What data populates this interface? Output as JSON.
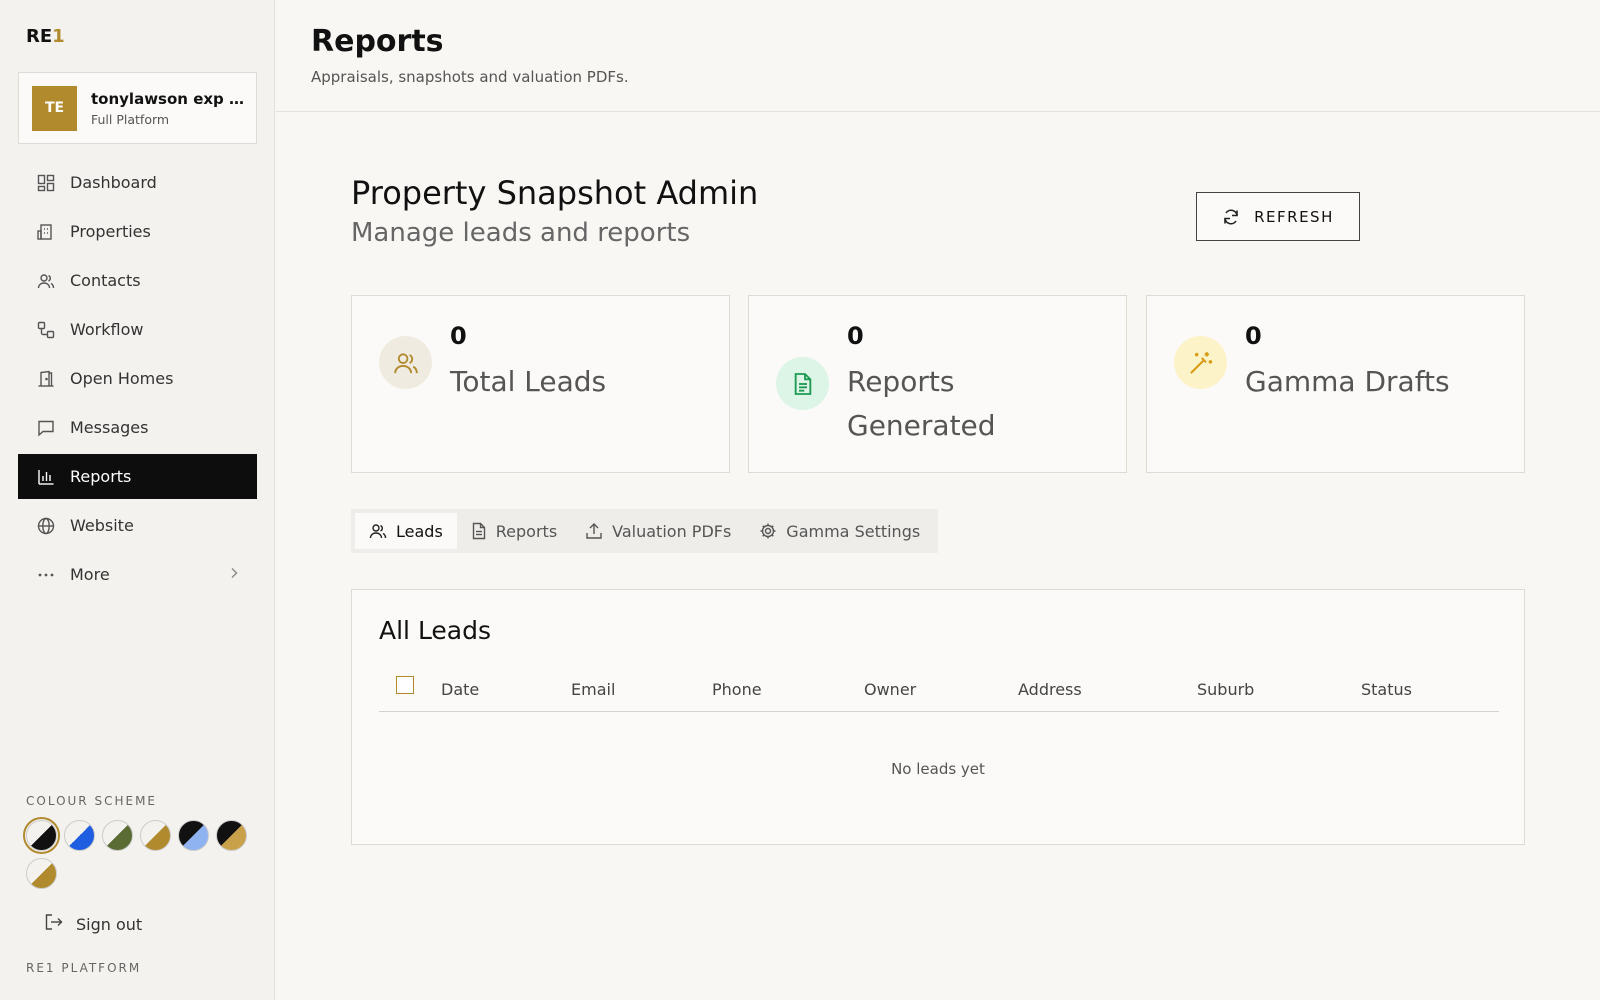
{
  "brand": {
    "logo_main": "RE",
    "logo_accent": "1",
    "accent": "#b08a2c"
  },
  "account": {
    "initials": "TE",
    "name": "tonylawson exp &...",
    "plan": "Full Platform"
  },
  "nav": [
    {
      "label": "Dashboard",
      "icon": "dashboard-icon"
    },
    {
      "label": "Properties",
      "icon": "building-icon"
    },
    {
      "label": "Contacts",
      "icon": "users-icon"
    },
    {
      "label": "Workflow",
      "icon": "workflow-icon"
    },
    {
      "label": "Open Homes",
      "icon": "door-icon"
    },
    {
      "label": "Messages",
      "icon": "message-icon"
    },
    {
      "label": "Reports",
      "icon": "bar-chart-icon",
      "active": true
    },
    {
      "label": "Website",
      "icon": "globe-icon"
    },
    {
      "label": "More",
      "icon": "more-icon"
    }
  ],
  "colour_scheme": {
    "label": "COLOUR SCHEME",
    "swatches": [
      {
        "a": "#f3f2ef",
        "b": "#111111",
        "selected": true
      },
      {
        "a": "#f3f2ef",
        "b": "#1f5ee0"
      },
      {
        "a": "#f3f2ef",
        "b": "#5a6b34"
      },
      {
        "a": "#f3f2ef",
        "b": "#b08a2c"
      },
      {
        "a": "#111111",
        "b": "#8fb2f0"
      },
      {
        "a": "#111111",
        "b": "#c9a14a"
      },
      {
        "a": "#f3f2ef",
        "b": "#b08a2c"
      }
    ]
  },
  "sidebar_footer": {
    "sign_out": "Sign out",
    "platform": "RE1 PLATFORM"
  },
  "header": {
    "title": "Reports",
    "subtitle": "Appraisals, snapshots and valuation PDFs."
  },
  "admin": {
    "title": "Property Snapshot Admin",
    "subtitle": "Manage leads and reports",
    "refresh_label": "REFRESH"
  },
  "stats": [
    {
      "value": "0",
      "label": "Total Leads",
      "icon": "users-icon",
      "bg": "#f0ebe0",
      "fg": "#b08a2c"
    },
    {
      "value": "0",
      "label": "Reports Generated",
      "icon": "file-text-icon",
      "bg": "#dcf5e6",
      "fg": "#1f9a55"
    },
    {
      "value": "0",
      "label": "Gamma Drafts",
      "icon": "magic-wand-icon",
      "bg": "#fdf3c8",
      "fg": "#d89a12"
    }
  ],
  "tabs": [
    {
      "label": "Leads",
      "icon": "users-icon",
      "active": true
    },
    {
      "label": "Reports",
      "icon": "file-icon"
    },
    {
      "label": "Valuation PDFs",
      "icon": "upload-icon"
    },
    {
      "label": "Gamma Settings",
      "icon": "gear-icon"
    }
  ],
  "leads_table": {
    "title": "All Leads",
    "columns": [
      "Date",
      "Email",
      "Phone",
      "Owner",
      "Address",
      "Suburb",
      "Status"
    ],
    "empty_text": "No leads yet"
  }
}
